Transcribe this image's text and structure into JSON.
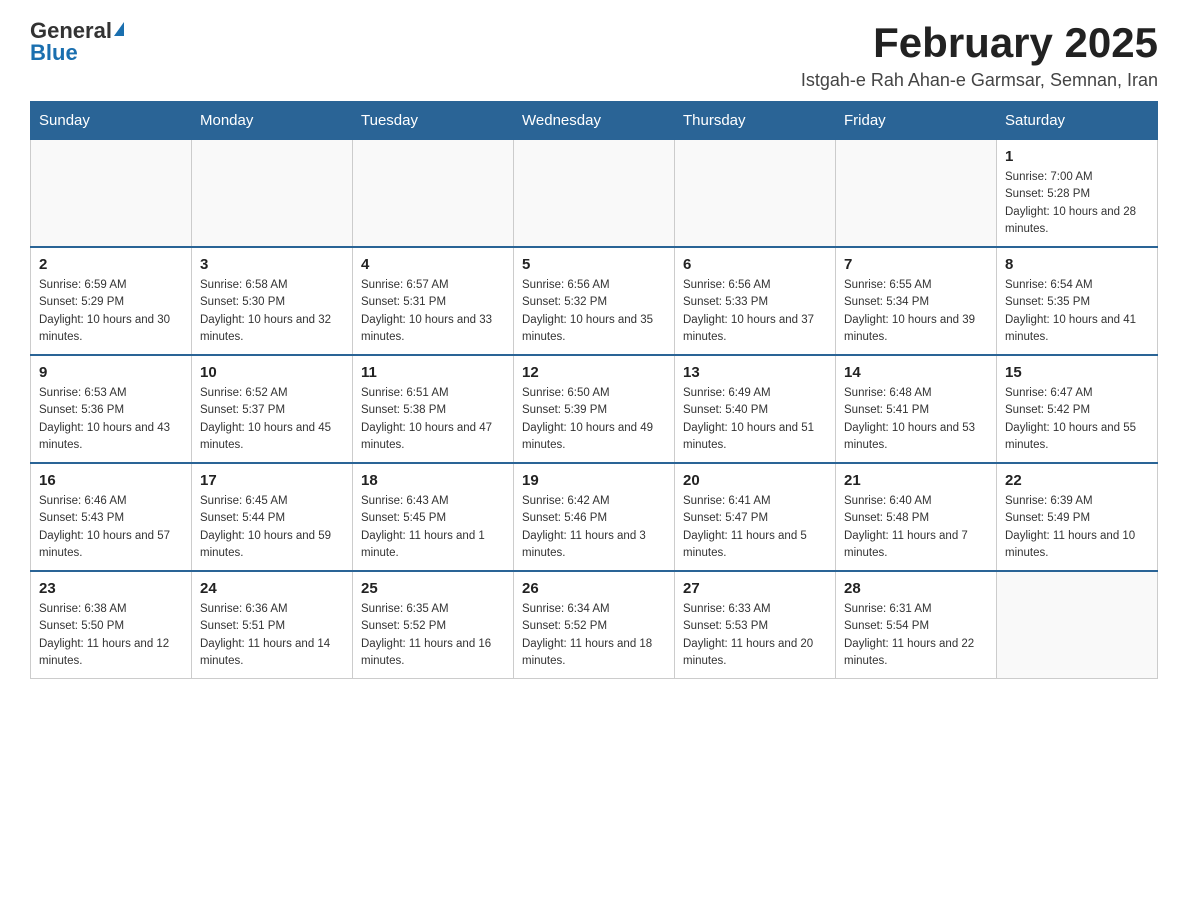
{
  "logo": {
    "general": "General",
    "blue": "Blue"
  },
  "title": "February 2025",
  "subtitle": "Istgah-e Rah Ahan-e Garmsar, Semnan, Iran",
  "days_of_week": [
    "Sunday",
    "Monday",
    "Tuesday",
    "Wednesday",
    "Thursday",
    "Friday",
    "Saturday"
  ],
  "weeks": [
    [
      {
        "day": "",
        "info": ""
      },
      {
        "day": "",
        "info": ""
      },
      {
        "day": "",
        "info": ""
      },
      {
        "day": "",
        "info": ""
      },
      {
        "day": "",
        "info": ""
      },
      {
        "day": "",
        "info": ""
      },
      {
        "day": "1",
        "info": "Sunrise: 7:00 AM\nSunset: 5:28 PM\nDaylight: 10 hours and 28 minutes."
      }
    ],
    [
      {
        "day": "2",
        "info": "Sunrise: 6:59 AM\nSunset: 5:29 PM\nDaylight: 10 hours and 30 minutes."
      },
      {
        "day": "3",
        "info": "Sunrise: 6:58 AM\nSunset: 5:30 PM\nDaylight: 10 hours and 32 minutes."
      },
      {
        "day": "4",
        "info": "Sunrise: 6:57 AM\nSunset: 5:31 PM\nDaylight: 10 hours and 33 minutes."
      },
      {
        "day": "5",
        "info": "Sunrise: 6:56 AM\nSunset: 5:32 PM\nDaylight: 10 hours and 35 minutes."
      },
      {
        "day": "6",
        "info": "Sunrise: 6:56 AM\nSunset: 5:33 PM\nDaylight: 10 hours and 37 minutes."
      },
      {
        "day": "7",
        "info": "Sunrise: 6:55 AM\nSunset: 5:34 PM\nDaylight: 10 hours and 39 minutes."
      },
      {
        "day": "8",
        "info": "Sunrise: 6:54 AM\nSunset: 5:35 PM\nDaylight: 10 hours and 41 minutes."
      }
    ],
    [
      {
        "day": "9",
        "info": "Sunrise: 6:53 AM\nSunset: 5:36 PM\nDaylight: 10 hours and 43 minutes."
      },
      {
        "day": "10",
        "info": "Sunrise: 6:52 AM\nSunset: 5:37 PM\nDaylight: 10 hours and 45 minutes."
      },
      {
        "day": "11",
        "info": "Sunrise: 6:51 AM\nSunset: 5:38 PM\nDaylight: 10 hours and 47 minutes."
      },
      {
        "day": "12",
        "info": "Sunrise: 6:50 AM\nSunset: 5:39 PM\nDaylight: 10 hours and 49 minutes."
      },
      {
        "day": "13",
        "info": "Sunrise: 6:49 AM\nSunset: 5:40 PM\nDaylight: 10 hours and 51 minutes."
      },
      {
        "day": "14",
        "info": "Sunrise: 6:48 AM\nSunset: 5:41 PM\nDaylight: 10 hours and 53 minutes."
      },
      {
        "day": "15",
        "info": "Sunrise: 6:47 AM\nSunset: 5:42 PM\nDaylight: 10 hours and 55 minutes."
      }
    ],
    [
      {
        "day": "16",
        "info": "Sunrise: 6:46 AM\nSunset: 5:43 PM\nDaylight: 10 hours and 57 minutes."
      },
      {
        "day": "17",
        "info": "Sunrise: 6:45 AM\nSunset: 5:44 PM\nDaylight: 10 hours and 59 minutes."
      },
      {
        "day": "18",
        "info": "Sunrise: 6:43 AM\nSunset: 5:45 PM\nDaylight: 11 hours and 1 minute."
      },
      {
        "day": "19",
        "info": "Sunrise: 6:42 AM\nSunset: 5:46 PM\nDaylight: 11 hours and 3 minutes."
      },
      {
        "day": "20",
        "info": "Sunrise: 6:41 AM\nSunset: 5:47 PM\nDaylight: 11 hours and 5 minutes."
      },
      {
        "day": "21",
        "info": "Sunrise: 6:40 AM\nSunset: 5:48 PM\nDaylight: 11 hours and 7 minutes."
      },
      {
        "day": "22",
        "info": "Sunrise: 6:39 AM\nSunset: 5:49 PM\nDaylight: 11 hours and 10 minutes."
      }
    ],
    [
      {
        "day": "23",
        "info": "Sunrise: 6:38 AM\nSunset: 5:50 PM\nDaylight: 11 hours and 12 minutes."
      },
      {
        "day": "24",
        "info": "Sunrise: 6:36 AM\nSunset: 5:51 PM\nDaylight: 11 hours and 14 minutes."
      },
      {
        "day": "25",
        "info": "Sunrise: 6:35 AM\nSunset: 5:52 PM\nDaylight: 11 hours and 16 minutes."
      },
      {
        "day": "26",
        "info": "Sunrise: 6:34 AM\nSunset: 5:52 PM\nDaylight: 11 hours and 18 minutes."
      },
      {
        "day": "27",
        "info": "Sunrise: 6:33 AM\nSunset: 5:53 PM\nDaylight: 11 hours and 20 minutes."
      },
      {
        "day": "28",
        "info": "Sunrise: 6:31 AM\nSunset: 5:54 PM\nDaylight: 11 hours and 22 minutes."
      },
      {
        "day": "",
        "info": ""
      }
    ]
  ]
}
